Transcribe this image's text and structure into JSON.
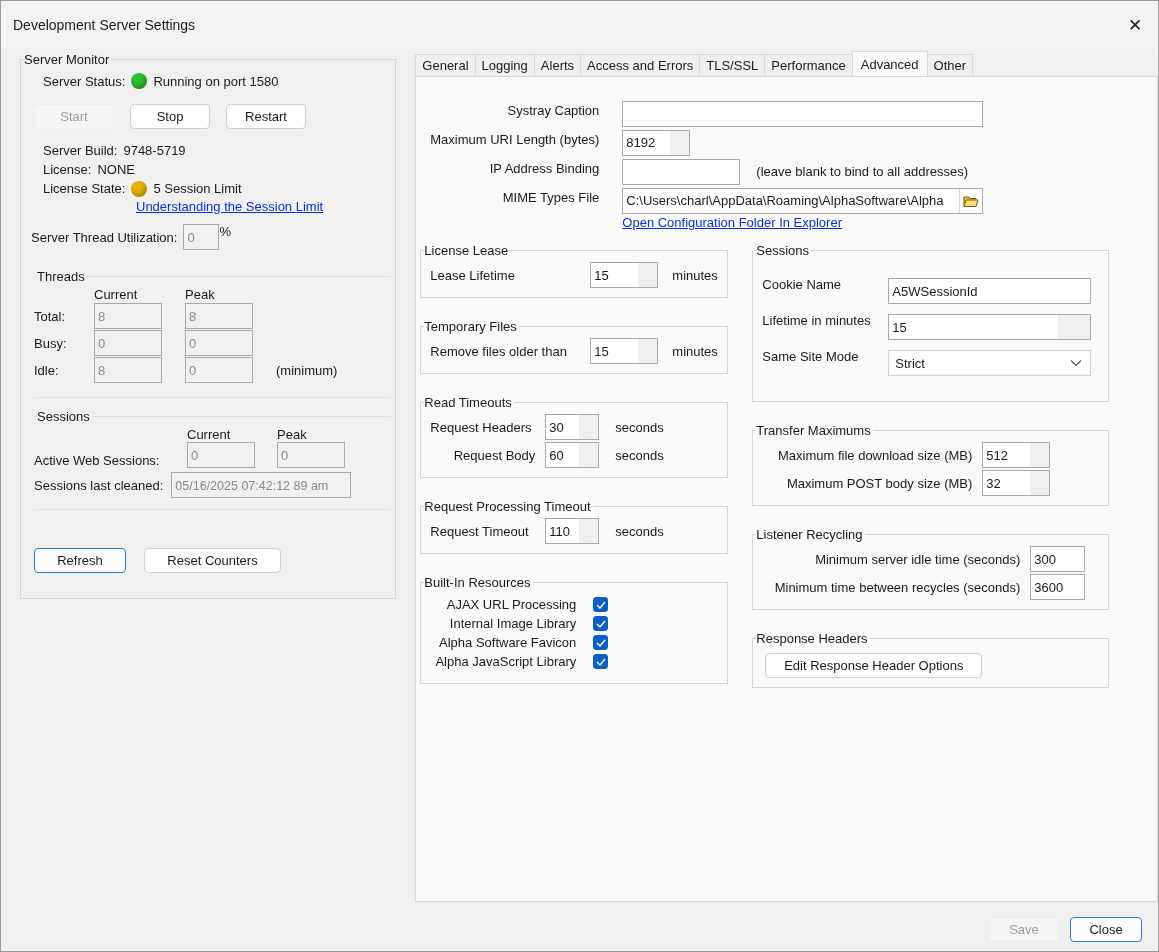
{
  "window": {
    "title": "Development Server Settings",
    "close": "✕"
  },
  "monitor": {
    "title": "Server Monitor",
    "status": {
      "label": "Server Status:",
      "color": "#2fbf2f",
      "text": "Running on port  1580"
    },
    "buttons": [
      {
        "label": "Start",
        "disabled": true
      },
      {
        "label": "Stop",
        "disabled": false
      },
      {
        "label": "Restart",
        "disabled": false
      }
    ],
    "info": [
      {
        "label": "Server Build:",
        "value": "9748-5719"
      },
      {
        "label": "License:",
        "value": "NONE"
      }
    ],
    "license_state": {
      "label": "License State:",
      "color": "#e3b60c",
      "text": "5 Session Limit"
    },
    "link": "Understanding the Session Limit",
    "utilization_label": "Server Thread Utilization:",
    "utilization": "0",
    "percent": "%"
  },
  "threads": {
    "title": "Threads",
    "col_current": "Current",
    "col_peak": "Peak",
    "rows": [
      {
        "label": "Total:",
        "current": "8",
        "peak": "8"
      },
      {
        "label": "Busy:",
        "current": "0",
        "peak": "0"
      },
      {
        "label": "Idle:",
        "current": "8",
        "peak": "0",
        "note": "(minimum)"
      }
    ]
  },
  "sessions_monitor": {
    "title": "Sessions",
    "col_current": "Current",
    "col_peak": "Peak",
    "active_label": "Active Web Sessions:",
    "current": "0",
    "peak": "0",
    "cleaned_label": "Sessions last cleaned:",
    "cleaned": "05/16/2025 07:42:12 89 am"
  },
  "monitor_buttons": [
    {
      "label": "Refresh",
      "default": true
    },
    {
      "label": "Reset Counters",
      "default": false
    }
  ],
  "tabs": [
    {
      "label": "General",
      "selected": false
    },
    {
      "label": "Logging",
      "selected": false
    },
    {
      "label": "Alerts",
      "selected": false
    },
    {
      "label": "Access and Errors",
      "selected": false
    },
    {
      "label": "TLS/SSL",
      "selected": false
    },
    {
      "label": "Performance",
      "selected": false
    },
    {
      "label": "Advanced",
      "selected": true
    },
    {
      "label": "Other",
      "selected": false
    }
  ],
  "top_fields": [
    {
      "label": "Systray Caption",
      "kind": "text"
    },
    {
      "label": "Maximum URI Length (bytes)",
      "kind": "spin",
      "value": "8192"
    },
    {
      "label": "IP Address Binding",
      "kind": "text",
      "note": "(leave blank to bind to all addresses)"
    },
    {
      "label": "MIME Types File",
      "kind": "file",
      "value": "C:\\Users\\charl\\AppData\\Roaming\\AlphaSoftware\\Alpha"
    }
  ],
  "config_link": "Open Configuration Folder In Explorer",
  "left_groups": [
    {
      "title": "License Lease",
      "rows": [
        {
          "kind": "spin",
          "label": "Lease Lifetime",
          "value": "15",
          "unit": "minutes"
        }
      ]
    },
    {
      "title": "Temporary Files",
      "rows": [
        {
          "kind": "spin",
          "label": "Remove files older than",
          "value": "15",
          "unit": "minutes"
        }
      ]
    },
    {
      "title": "Read Timeouts",
      "rows": [
        {
          "kind": "spin",
          "label": "Request Headers",
          "value": "30",
          "unit": "seconds"
        },
        {
          "kind": "spin",
          "label": "Request Body",
          "value": "60",
          "unit": "seconds"
        }
      ]
    },
    {
      "title": "Request Processing Timeout",
      "rows": [
        {
          "kind": "spin",
          "label": "Request Timeout",
          "value": "110",
          "unit": "seconds"
        }
      ]
    },
    {
      "title": "Built-In Resources",
      "rows": [
        {
          "kind": "check",
          "label": "AJAX URL Processing",
          "checked": true
        },
        {
          "kind": "check",
          "label": "Internal Image Library",
          "checked": true
        },
        {
          "kind": "check",
          "label": "Alpha Software Favicon",
          "checked": true
        },
        {
          "kind": "check",
          "label": "Alpha JavaScript Library",
          "checked": true
        }
      ]
    }
  ],
  "right_groups": [
    {
      "title": "Sessions",
      "rows": [
        {
          "kind": "text",
          "label": "Cookie Name",
          "value": "A5WSessionId"
        },
        {
          "kind": "spin",
          "label": "Lifetime in minutes",
          "value": "15"
        },
        {
          "kind": "select",
          "label": "Same Site Mode",
          "value": "Strict"
        }
      ]
    },
    {
      "title": "Transfer Maximums",
      "rows": [
        {
          "kind": "spin",
          "label": "Maximum file download size (MB)",
          "value": "512"
        },
        {
          "kind": "spin",
          "label": "Maximum POST body size (MB)",
          "value": "32"
        }
      ]
    },
    {
      "title": "Listener Recycling",
      "rows": [
        {
          "kind": "text",
          "label": "Minimum server idle time (seconds)",
          "value": "300"
        },
        {
          "kind": "text",
          "label": "Minimum time between recycles (seconds)",
          "value": "3600"
        }
      ]
    },
    {
      "title": "Response Headers",
      "rows": [
        {
          "kind": "button",
          "label": "Edit Response Header Options"
        }
      ]
    }
  ],
  "footer_buttons": [
    {
      "label": "Save",
      "disabled": true,
      "default": false
    },
    {
      "label": "Close",
      "disabled": false,
      "default": true
    }
  ]
}
